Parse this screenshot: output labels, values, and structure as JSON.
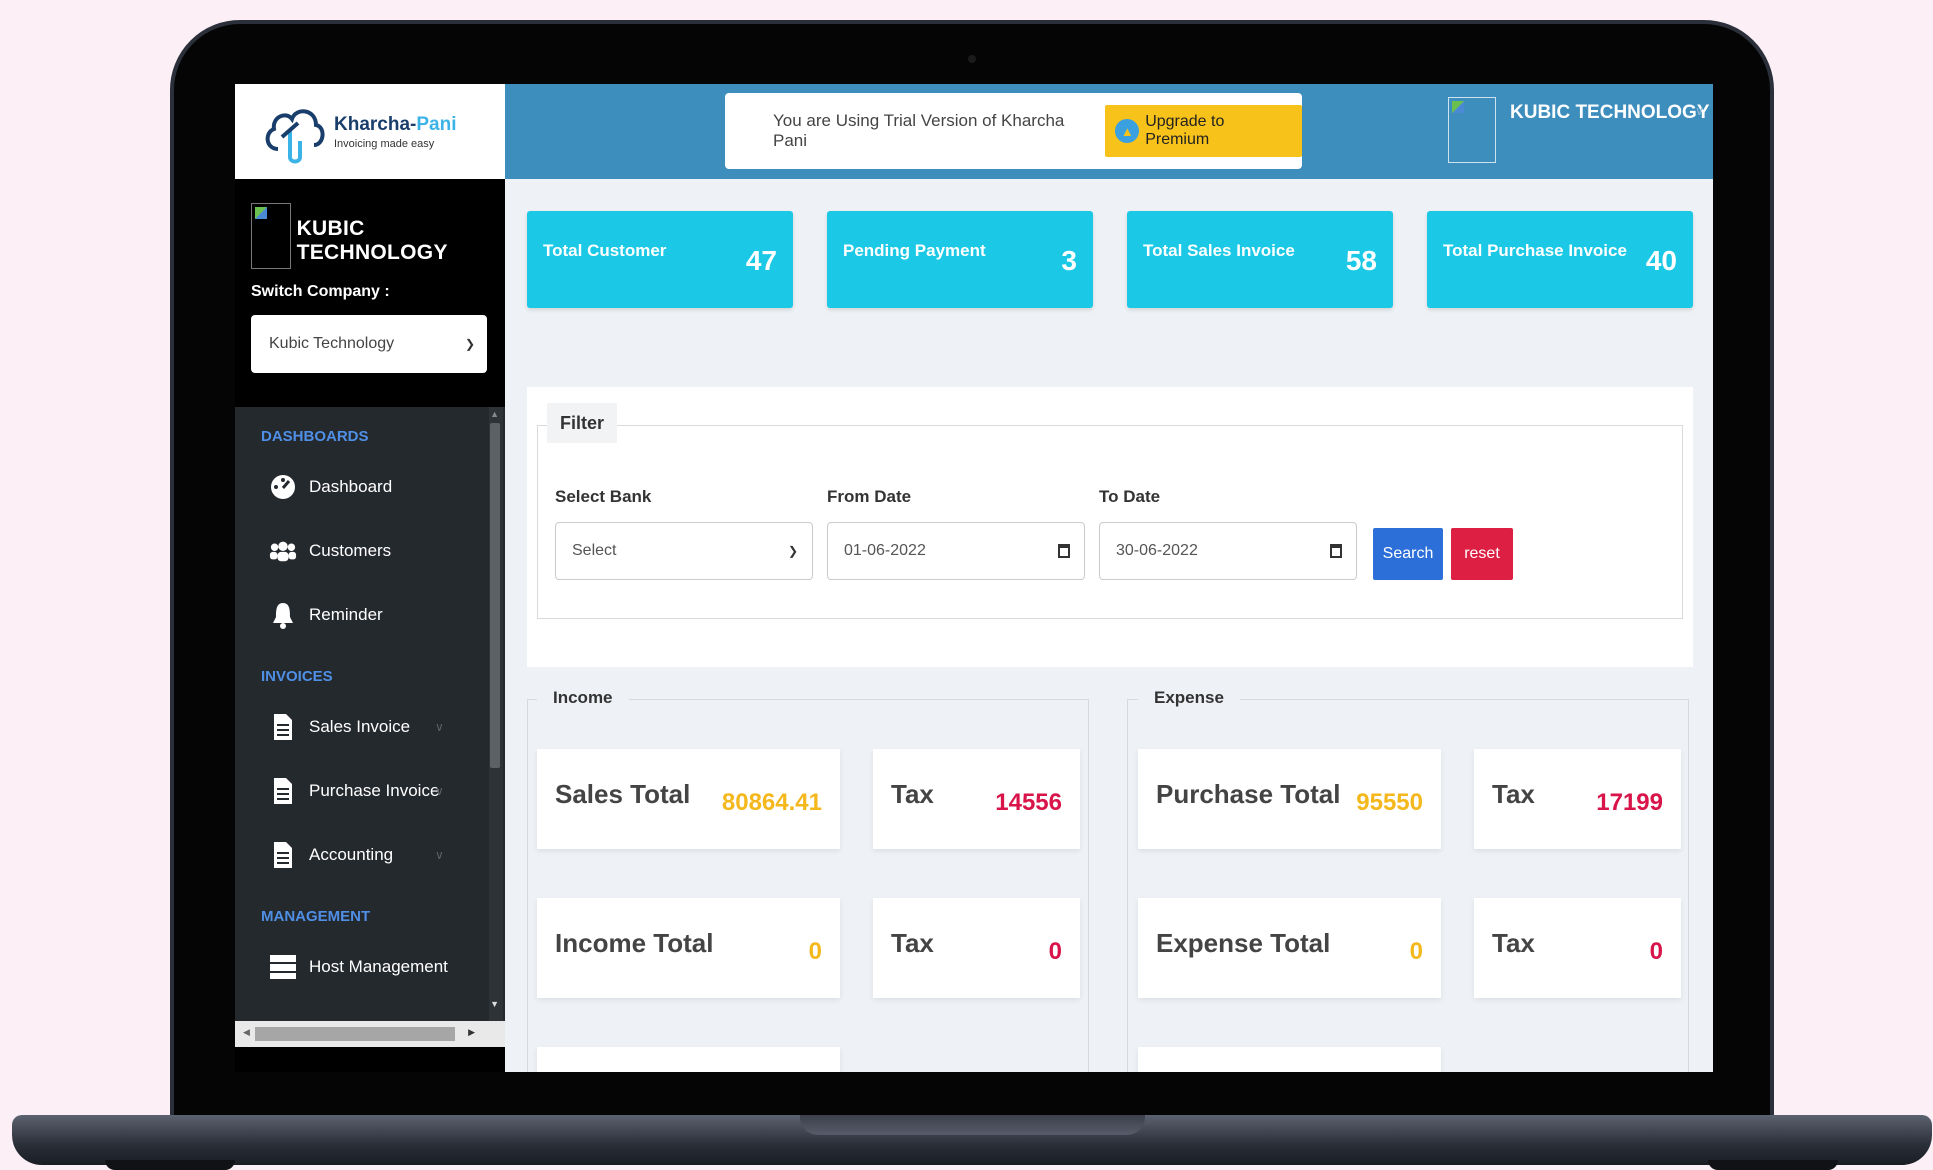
{
  "brand": {
    "name_dark": "Kharcha-",
    "name_accent": "Pani",
    "tagline": "Invoicing made easy"
  },
  "sidebar": {
    "company_name": "KUBIC TECHNOLOGY",
    "switch_label": "Switch Company :",
    "company_select_value": "Kubic Technology",
    "sections": {
      "dashboards": "DASHBOARDS",
      "invoices": "INVOICES",
      "management": "MANAGEMENT"
    },
    "items": {
      "dashboard": "Dashboard",
      "customers": "Customers",
      "reminder": "Reminder",
      "sales_invoice": "Sales Invoice",
      "purchase_invoice": "Purchase Invoice",
      "accounting": "Accounting",
      "host_management": "Host Management"
    }
  },
  "topbar": {
    "trial_text": "You are Using Trial Version of Kharcha Pani",
    "upgrade_label": "Upgrade to Premium",
    "user_name": "KUBIC TECHNOLOGY"
  },
  "stats": [
    {
      "label": "Total Customer",
      "value": "47"
    },
    {
      "label": "Pending Payment",
      "value": "3"
    },
    {
      "label": "Total Sales Invoice",
      "value": "58"
    },
    {
      "label": "Total Purchase Invoice",
      "value": "40"
    }
  ],
  "filter": {
    "legend": "Filter",
    "bank_label": "Select Bank",
    "bank_value": "Select",
    "from_label": "From Date",
    "from_value": "01-06-2022",
    "to_label": "To Date",
    "to_value": "30-06-2022",
    "search_label": "Search",
    "reset_label": "reset"
  },
  "income": {
    "legend": "Income",
    "sales_total_label": "Sales Total",
    "sales_total_value": "80864.41",
    "sales_tax_label": "Tax",
    "sales_tax_value": "14556",
    "income_total_label": "Income Total",
    "income_total_value": "0",
    "income_tax_label": "Tax",
    "income_tax_value": "0"
  },
  "expense": {
    "legend": "Expense",
    "purchase_total_label": "Purchase Total",
    "purchase_total_value": "95550",
    "purchase_tax_label": "Tax",
    "purchase_tax_value": "17199",
    "expense_total_label": "Expense Total",
    "expense_total_value": "0",
    "expense_tax_label": "Tax",
    "expense_tax_value": "0"
  },
  "colors": {
    "topbar": "#3d8dbd",
    "stat_card": "#1bc9e6",
    "total_value": "#f4b81d",
    "tax_value": "#d8144a",
    "search_btn": "#2d6fd8",
    "reset_btn": "#dc1f42"
  }
}
